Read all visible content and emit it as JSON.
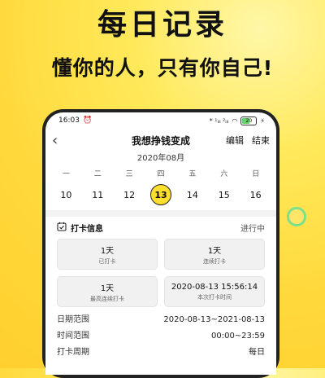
{
  "promo": {
    "headline": "每日记录",
    "subheadline": "懂你的人，只有你自己!"
  },
  "status_bar": {
    "time": "16:03",
    "network": "* ¹ᵢₗₗ ²ᵢₗₗ",
    "battery": "20"
  },
  "nav": {
    "title": "我想挣钱变成",
    "edit": "编辑",
    "finish": "结束"
  },
  "calendar": {
    "month": "2020年08月",
    "weekdays": [
      "一",
      "二",
      "三",
      "四",
      "五",
      "六",
      "日"
    ],
    "dates": [
      "10",
      "11",
      "12",
      "13",
      "14",
      "15",
      "16"
    ],
    "selected_index": 3
  },
  "checkin": {
    "title": "打卡信息",
    "status": "进行中",
    "cards": [
      {
        "value": "1天",
        "label": "已打卡"
      },
      {
        "value": "1天",
        "label": "连续打卡"
      },
      {
        "value": "1天",
        "label": "最高连续打卡"
      },
      {
        "value": "2020-08-13 15:56:14",
        "label": "本次打卡时间"
      }
    ],
    "rows": [
      {
        "label": "日期范围",
        "value": "2020-08-13~2021-08-13"
      },
      {
        "label": "时间范围",
        "value": "00:00~23:59"
      },
      {
        "label": "打卡周期",
        "value": "每日"
      }
    ]
  }
}
